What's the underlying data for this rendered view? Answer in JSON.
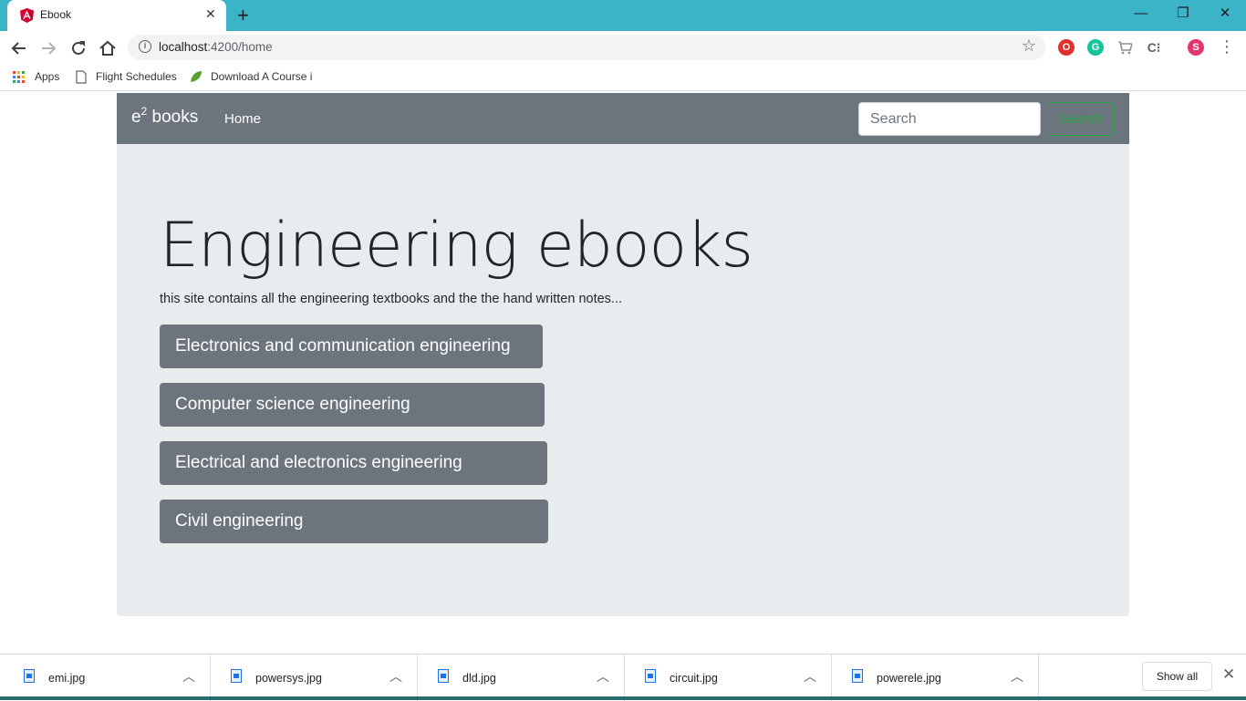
{
  "browser": {
    "tab_title": "Ebook",
    "tab_close": "✕",
    "new_tab": "+",
    "window_controls": {
      "minimize": "—",
      "restore": "❐",
      "close": "✕"
    },
    "url_host": "localhost",
    "url_path": ":4200/home",
    "profile_initial": "S",
    "bookmarks": [
      {
        "label": "Apps"
      },
      {
        "label": "Flight Schedules"
      },
      {
        "label": "Download A Course i"
      }
    ]
  },
  "navbar": {
    "brand_main": "e",
    "brand_sup": "2",
    "brand_rest": " books",
    "home_link": "Home",
    "search_placeholder": "Search",
    "search_button": "Search"
  },
  "hero": {
    "title": "Engineering ebooks",
    "lead": "this site contains all the engineering textbooks and the the hand written notes...",
    "categories": [
      {
        "label": "Electronics and communication engineering"
      },
      {
        "label": "Computer science engineering"
      },
      {
        "label": "Electrical and electronics engineering"
      },
      {
        "label": "Civil engineering"
      }
    ]
  },
  "downloads": {
    "items": [
      {
        "name": "emi.jpg"
      },
      {
        "name": "powersys.jpg"
      },
      {
        "name": "dld.jpg"
      },
      {
        "name": "circuit.jpg"
      },
      {
        "name": "powerele.jpg"
      }
    ],
    "show_all": "Show all",
    "close": "✕"
  },
  "colors": {
    "titlebar": "#3cb4c8",
    "navbar": "#6c757d",
    "jumbotron": "#e9ecef",
    "search_button": "#28a745",
    "category_button": "#6c757d"
  }
}
